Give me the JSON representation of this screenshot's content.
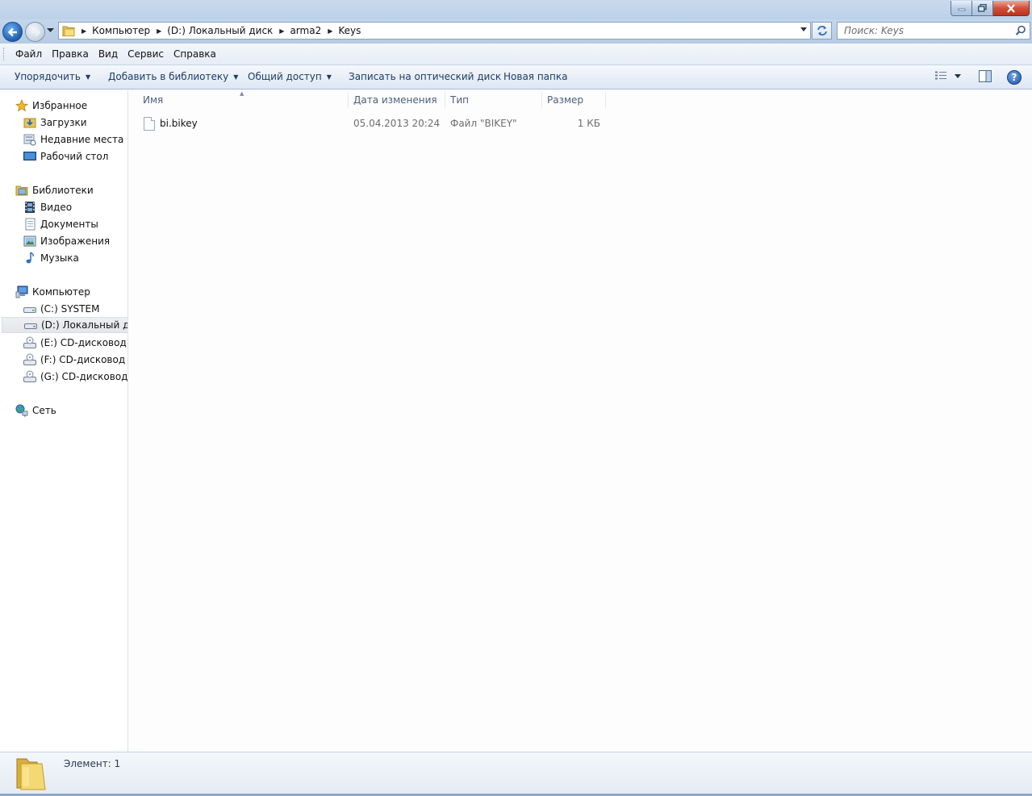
{
  "window": {
    "min_glyph": "▁",
    "close_glyph": "✕"
  },
  "address": {
    "breadcrumbs": [
      "Компьютер",
      "(D:) Локальный диск",
      "arma2",
      "Keys"
    ]
  },
  "search": {
    "placeholder": "Поиск: Keys"
  },
  "menu": {
    "items": [
      "Файл",
      "Правка",
      "Вид",
      "Сервис",
      "Справка"
    ]
  },
  "toolbar": {
    "organize": "Упорядочить",
    "add_to_library": "Добавить в библиотеку",
    "share": "Общий доступ",
    "burn": "Записать на оптический диск",
    "new_folder": "Новая папка",
    "help": "?"
  },
  "nav": {
    "favorites": {
      "label": "Избранное",
      "items": [
        "Загрузки",
        "Недавние места",
        "Рабочий стол"
      ]
    },
    "libraries": {
      "label": "Библиотеки",
      "items": [
        "Видео",
        "Документы",
        "Изображения",
        "Музыка"
      ]
    },
    "computer": {
      "label": "Компьютер",
      "items": [
        "(C:) SYSTEM",
        "(D:) Локальный диск",
        "(E:) CD-дисковод",
        "(F:) CD-дисковод - V",
        "(G:) CD-дисковод - ."
      ]
    },
    "network": {
      "label": "Сеть"
    }
  },
  "file_list": {
    "columns": [
      "Имя",
      "Дата изменения",
      "Тип",
      "Размер"
    ],
    "rows": [
      {
        "name": "bi.bikey",
        "date": "05.04.2013 20:24",
        "type": "Файл \"BIKEY\"",
        "size": "1 КБ"
      }
    ]
  },
  "details": {
    "count": "Элемент: 1"
  },
  "colors": {
    "accent": "#1e5fb3",
    "link_text": "#1e3d66",
    "meta_text": "#6d6d6d"
  }
}
